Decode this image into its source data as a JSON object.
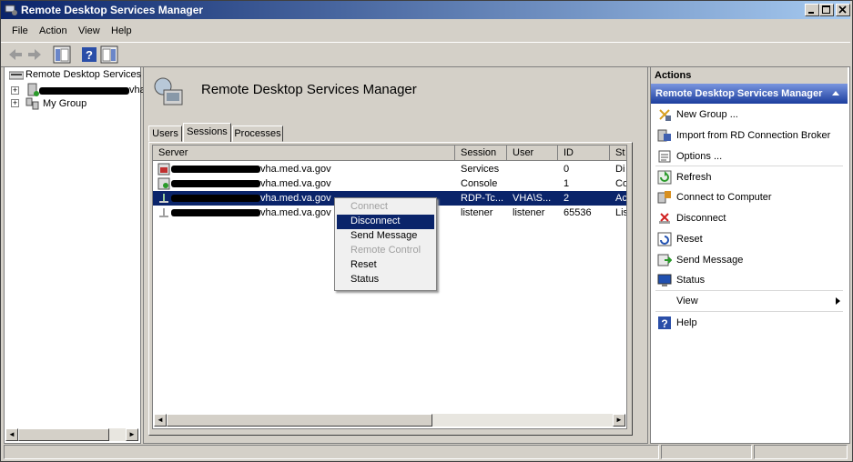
{
  "window": {
    "title": "Remote Desktop Services Manager"
  },
  "menu": [
    "File",
    "Action",
    "View",
    "Help"
  ],
  "tree": {
    "root": "Remote Desktop Services M",
    "server_suffix": "vha",
    "group": "My Group"
  },
  "center": {
    "header_title": "Remote Desktop Services Manager",
    "tabs": [
      "Users",
      "Sessions",
      "Processes"
    ],
    "active_tab": "Sessions",
    "columns": [
      "Server",
      "Session",
      "User",
      "ID",
      "St"
    ],
    "rows": [
      {
        "server": "vha.med.va.gov",
        "session": "Services",
        "user": "",
        "id": "0",
        "status": "Di"
      },
      {
        "server": "vha.med.va.gov",
        "session": "Console",
        "user": "",
        "id": "1",
        "status": "Co"
      },
      {
        "server": "vha.med.va.gov",
        "session": "RDP-Tc...",
        "user": "VHA\\S...",
        "id": "2",
        "status": "Ac"
      },
      {
        "server": "vha.med.va.gov",
        "session": "listener",
        "user": "listener",
        "id": "65536",
        "status": "Lis"
      }
    ]
  },
  "context_menu": [
    {
      "label": "Connect",
      "enabled": false
    },
    {
      "label": "Disconnect",
      "enabled": true,
      "highlighted": true
    },
    {
      "label": "Send Message",
      "enabled": true
    },
    {
      "label": "Remote Control",
      "enabled": false
    },
    {
      "label": "Reset",
      "enabled": true
    },
    {
      "label": "Status",
      "enabled": true
    }
  ],
  "actions": {
    "header": "Actions",
    "section": "Remote Desktop Services Manager",
    "items": [
      {
        "label": "New Group ...",
        "icon": "new-group-icon"
      },
      {
        "label": "Import from RD Connection Broker",
        "icon": "import-icon"
      },
      {
        "label": "Options ...",
        "icon": "options-icon"
      },
      {
        "label": "Refresh",
        "icon": "refresh-icon"
      },
      {
        "label": "Connect to Computer",
        "icon": "connect-computer-icon"
      },
      {
        "label": "Disconnect",
        "icon": "disconnect-icon"
      },
      {
        "label": "Reset",
        "icon": "reset-icon"
      },
      {
        "label": "Send Message",
        "icon": "send-message-icon"
      },
      {
        "label": "Status",
        "icon": "status-icon"
      },
      {
        "label": "View",
        "icon": ""
      },
      {
        "label": "Help",
        "icon": "help-icon"
      }
    ]
  },
  "colors": {
    "selection": "#0a246a",
    "title_start": "#0a246a",
    "title_end": "#a6caf0"
  }
}
